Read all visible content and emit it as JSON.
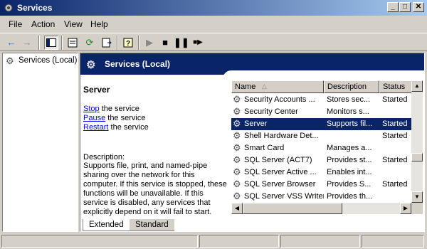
{
  "window": {
    "title": "Services",
    "controls": [
      "_",
      "□",
      "✕"
    ]
  },
  "menu": [
    "File",
    "Action",
    "View",
    "Help"
  ],
  "tree": {
    "root_label": "Services (Local)"
  },
  "header": {
    "title": "Services (Local)"
  },
  "detail": {
    "service_name": "Server",
    "actions": [
      {
        "link": "Stop",
        "rest": " the service"
      },
      {
        "link": "Pause",
        "rest": " the service"
      },
      {
        "link": "Restart",
        "rest": " the service"
      }
    ],
    "description_label": "Description:",
    "description_text": "Supports file, print, and named-pipe sharing over the network for this computer. If this service is stopped, these functions will be unavailable. If this service is disabled, any services that explicitly depend on it will fail to start."
  },
  "list": {
    "columns": [
      "Name",
      "Description",
      "Status"
    ],
    "rows": [
      {
        "name": "Security Accounts ...",
        "description": "Stores sec...",
        "status": "Started",
        "selected": false
      },
      {
        "name": "Security Center",
        "description": "Monitors s...",
        "status": "",
        "selected": false
      },
      {
        "name": "Server",
        "description": "Supports fil...",
        "status": "Started",
        "selected": true
      },
      {
        "name": "Shell Hardware Det...",
        "description": "",
        "status": "Started",
        "selected": false
      },
      {
        "name": "Smart Card",
        "description": "Manages a...",
        "status": "",
        "selected": false
      },
      {
        "name": "SQL Server (ACT7)",
        "description": "Provides st...",
        "status": "Started",
        "selected": false
      },
      {
        "name": "SQL Server Active ...",
        "description": "Enables int...",
        "status": "",
        "selected": false
      },
      {
        "name": "SQL Server Browser",
        "description": "Provides S...",
        "status": "Started",
        "selected": false
      },
      {
        "name": "SQL Server VSS Writer",
        "description": "Provides th...",
        "status": "",
        "selected": false
      }
    ]
  },
  "tabs": [
    "Extended",
    "Standard"
  ],
  "colors": {
    "title_start": "#0a246a",
    "title_end": "#a6caf0",
    "selection": "#0a246a",
    "link": "#0000ee"
  },
  "icons": [
    "back-arrow-icon",
    "forward-arrow-icon",
    "console-tree-icon",
    "properties-icon",
    "refresh-icon",
    "export-list-icon",
    "help-icon",
    "play-icon",
    "stop-icon",
    "pause-icon",
    "restart-icon",
    "gear-icon"
  ]
}
